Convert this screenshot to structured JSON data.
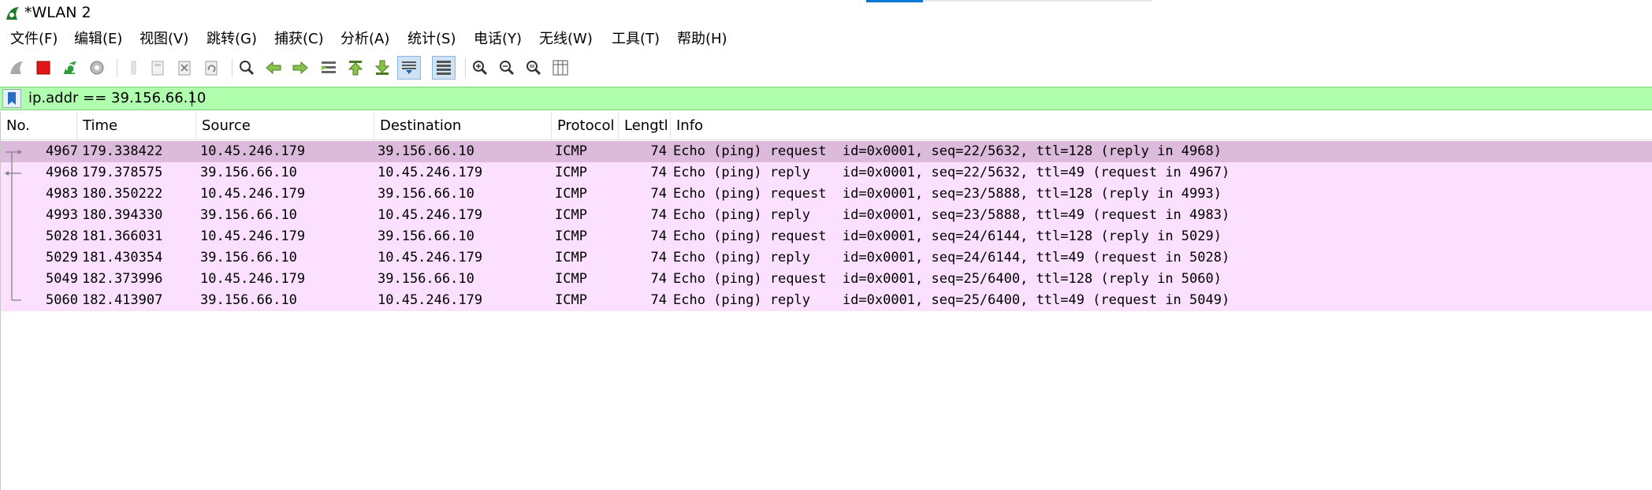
{
  "window": {
    "title": "*WLAN 2",
    "icon": "wireshark-fin-icon"
  },
  "menu": [
    {
      "label": "文件(F)"
    },
    {
      "label": "编辑(E)"
    },
    {
      "label": "视图(V)"
    },
    {
      "label": "跳转(G)"
    },
    {
      "label": "捕获(C)"
    },
    {
      "label": "分析(A)"
    },
    {
      "label": "统计(S)"
    },
    {
      "label": "电话(Y)"
    },
    {
      "label": "无线(W)"
    },
    {
      "label": "工具(T)"
    },
    {
      "label": "帮助(H)"
    }
  ],
  "toolbar": {
    "buttons": [
      "start-capture-icon",
      "stop-capture-icon",
      "restart-capture-icon",
      "capture-options-icon",
      "open-file-icon",
      "save-file-icon",
      "close-file-icon",
      "reload-file-icon",
      "find-packet-icon",
      "go-back-icon",
      "go-forward-icon",
      "go-to-packet-icon",
      "first-packet-icon",
      "last-packet-icon",
      "autoscroll-icon",
      "colorize-icon",
      "zoom-in-icon",
      "zoom-out-icon",
      "normal-size-icon",
      "resize-columns-icon"
    ]
  },
  "filter": {
    "value": "ip.addr == 39.156.66.10",
    "background": "#afffaf"
  },
  "columns": [
    "No.",
    "Time",
    "Source",
    "Destination",
    "Protocol",
    "Lengtl",
    "Info"
  ],
  "packets": [
    {
      "no": "4967",
      "time": "179.338422",
      "source": "10.45.246.179",
      "destination": "39.156.66.10",
      "protocol": "ICMP",
      "length": "74",
      "info": "Echo (ping) request  id=0x0001, seq=22/5632, ttl=128 (reply in 4968)"
    },
    {
      "no": "4968",
      "time": "179.378575",
      "source": "39.156.66.10",
      "destination": "10.45.246.179",
      "protocol": "ICMP",
      "length": "74",
      "info": "Echo (ping) reply    id=0x0001, seq=22/5632, ttl=49 (request in 4967)"
    },
    {
      "no": "4983",
      "time": "180.350222",
      "source": "10.45.246.179",
      "destination": "39.156.66.10",
      "protocol": "ICMP",
      "length": "74",
      "info": "Echo (ping) request  id=0x0001, seq=23/5888, ttl=128 (reply in 4993)"
    },
    {
      "no": "4993",
      "time": "180.394330",
      "source": "39.156.66.10",
      "destination": "10.45.246.179",
      "protocol": "ICMP",
      "length": "74",
      "info": "Echo (ping) reply    id=0x0001, seq=23/5888, ttl=49 (request in 4983)"
    },
    {
      "no": "5028",
      "time": "181.366031",
      "source": "10.45.246.179",
      "destination": "39.156.66.10",
      "protocol": "ICMP",
      "length": "74",
      "info": "Echo (ping) request  id=0x0001, seq=24/6144, ttl=128 (reply in 5029)"
    },
    {
      "no": "5029",
      "time": "181.430354",
      "source": "39.156.66.10",
      "destination": "10.45.246.179",
      "protocol": "ICMP",
      "length": "74",
      "info": "Echo (ping) reply    id=0x0001, seq=24/6144, ttl=49 (request in 5028)"
    },
    {
      "no": "5049",
      "time": "182.373996",
      "source": "10.45.246.179",
      "destination": "39.156.66.10",
      "protocol": "ICMP",
      "length": "74",
      "info": "Echo (ping) request  id=0x0001, seq=25/6400, ttl=128 (reply in 5060)"
    },
    {
      "no": "5060",
      "time": "182.413907",
      "source": "39.156.66.10",
      "destination": "10.45.246.179",
      "protocol": "ICMP",
      "length": "74",
      "info": "Echo (ping) reply    id=0x0001, seq=25/6400, ttl=49 (request in 5049)"
    }
  ],
  "colors": {
    "row_icmp": "#fce0ff",
    "row_selected": "#dcbadc"
  }
}
